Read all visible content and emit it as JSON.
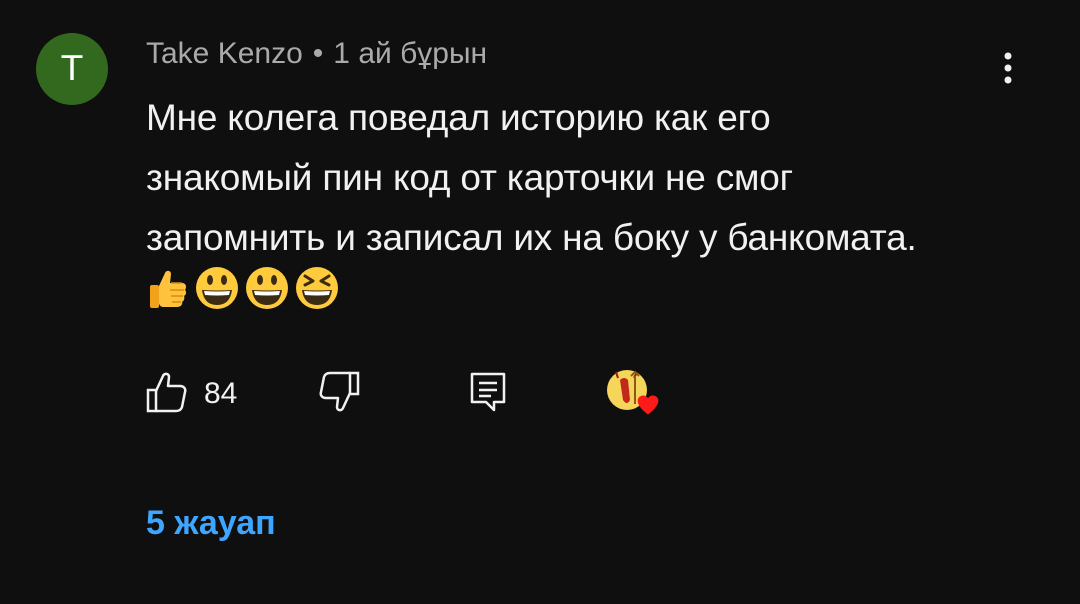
{
  "comment": {
    "avatar_letter": "T",
    "author": "Take Kenzo",
    "separator": "•",
    "time": "1 ай бұрын",
    "text": "Мне колега поведал историю как его знакомый пин код от карточки не смог запомнить и записал их на боку у банкомата.",
    "emojis": [
      "thumbs-up",
      "grinning-face",
      "grinning-face",
      "laughing-face"
    ]
  },
  "actions": {
    "like_count": "84",
    "like_icon": "thumbs-up-icon",
    "dislike_icon": "thumbs-down-icon",
    "reply_icon": "reply-icon",
    "creator_heart_icon": "creator-heart-icon"
  },
  "replies": {
    "label": "5 жауап"
  },
  "colors": {
    "background": "#0f0f0f",
    "avatar": "#33691e",
    "link": "#3ea6ff",
    "heart": "#ff0000"
  }
}
